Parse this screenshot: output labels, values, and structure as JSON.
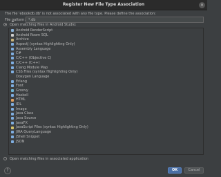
{
  "dialog": {
    "title": "Register New File Type Association",
    "close_glyph": "×",
    "message": "The file 'ebookdb.db' is not associated with any file type. Please define the association:",
    "pattern_label_prefix": "File ",
    "pattern_label_u": "p",
    "pattern_label_suffix": "attern:",
    "pattern_value": "*.db",
    "option_android_studio": "Open matching files in Android Studio:",
    "option_associated_app": "Open matching files in associated application",
    "help_glyph": "?",
    "ok_label": "OK",
    "cancel_label": "Cancel"
  },
  "file_types": [
    {
      "label": "Android RenderScript",
      "icon": "renderscript-icon",
      "color": "#8bb0d6"
    },
    {
      "label": "Android Room SQL",
      "icon": "room-sql-icon",
      "color": "#cfcfcf"
    },
    {
      "label": "Archive",
      "icon": "archive-icon",
      "color": "#c9b37a"
    },
    {
      "label": "AspectJ (syntax Highlighting Only)",
      "icon": "aspectj-icon",
      "color": "#7faee0"
    },
    {
      "label": "Assembly Language",
      "icon": "assembly-icon",
      "color": "#7faee0"
    },
    {
      "label": "C#",
      "icon": "csharp-icon",
      "color": "#7faee0"
    },
    {
      "label": "C/C++ (Objective C)",
      "icon": "objc-icon",
      "color": "#7faee0"
    },
    {
      "label": "C/C++ (C++)",
      "icon": "cpp-icon",
      "color": "#7faee0"
    },
    {
      "label": "Clang Module Map",
      "icon": "clang-icon",
      "color": "#7faee0"
    },
    {
      "label": "CSS Files (syntax Highlighting Only)",
      "icon": "css-icon",
      "color": "#7faee0"
    },
    {
      "label": "Doxygen Language",
      "icon": "doxygen-icon",
      "color": "#3c3f41"
    },
    {
      "label": "Erlang",
      "icon": "erlang-icon",
      "color": "#7faee0"
    },
    {
      "label": "Font",
      "icon": "font-icon",
      "color": "#7faee0"
    },
    {
      "label": "Groovy",
      "icon": "groovy-icon",
      "color": "#6fb4d2"
    },
    {
      "label": "Haskell",
      "icon": "haskell-icon",
      "color": "#7faee0"
    },
    {
      "label": "HTML",
      "icon": "html-icon",
      "color": "#e0a060"
    },
    {
      "label": "IDL",
      "icon": "idl-icon",
      "color": "#7faee0"
    },
    {
      "label": "Image",
      "icon": "image-icon",
      "color": "#7faee0"
    },
    {
      "label": "Java Class",
      "icon": "java-class-icon",
      "color": "#7faee0"
    },
    {
      "label": "Java Source",
      "icon": "java-source-icon",
      "color": "#7faee0"
    },
    {
      "label": "JavaFX",
      "icon": "javafx-icon",
      "color": "#7faee0"
    },
    {
      "label": "JavaScript Files (syntax Highlighting Only)",
      "icon": "javascript-icon",
      "color": "#d6c46a"
    },
    {
      "label": "JIRA QueryLanguage",
      "icon": "jira-icon",
      "color": "#7faee0"
    },
    {
      "label": "JShell Snippet",
      "icon": "jshell-icon",
      "color": "#7faee0"
    },
    {
      "label": "JSON",
      "icon": "json-icon",
      "color": "#7faee0"
    }
  ]
}
